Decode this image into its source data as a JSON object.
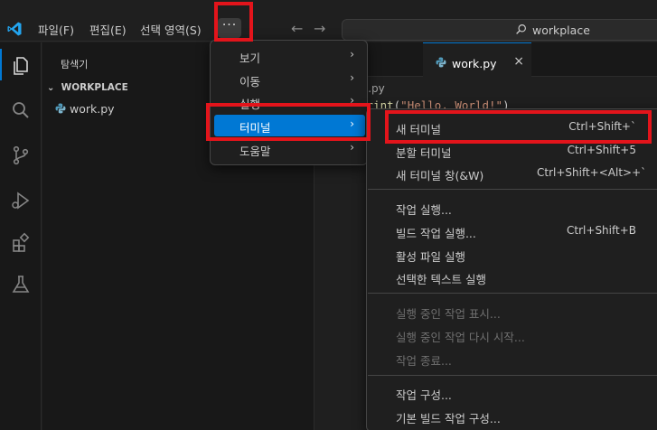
{
  "titlebar": {
    "menus": [
      "파일(F)",
      "편집(E)",
      "선택 영역(S)"
    ],
    "more_label": "···",
    "back_glyph": "←",
    "forward_glyph": "→",
    "search_text": "workplace"
  },
  "sidebar": {
    "title": "탐색기",
    "section": "WORKPLACE",
    "chevron": "⌄",
    "files": [
      "work.py"
    ]
  },
  "editor": {
    "tab_label": "work.py",
    "tab_close": "×",
    "breadcrumb": "ork.py",
    "code_fn": "print",
    "code_open": "(",
    "code_str": "\"Hello, World!\"",
    "code_close": ")"
  },
  "main_menu": {
    "items": [
      {
        "label": "보기",
        "arrow": "›"
      },
      {
        "label": "이동",
        "arrow": "›"
      },
      {
        "label": "실행",
        "arrow": "›"
      },
      {
        "label": "터미널",
        "arrow": "›"
      },
      {
        "label": "도움말",
        "arrow": "›"
      }
    ],
    "selected_index": 3
  },
  "terminal_menu": {
    "items": [
      {
        "label": "새 터미널",
        "shortcut": "Ctrl+Shift+`"
      },
      {
        "label": "분할 터미널",
        "shortcut": "Ctrl+Shift+5"
      },
      {
        "label": "새 터미널 창(&W)",
        "shortcut": "Ctrl+Shift+<Alt>+`"
      },
      {
        "label": "작업 실행...",
        "shortcut": ""
      },
      {
        "label": "빌드 작업 실행...",
        "shortcut": "Ctrl+Shift+B"
      },
      {
        "label": "활성 파일 실행",
        "shortcut": ""
      },
      {
        "label": "선택한 텍스트 실행",
        "shortcut": ""
      },
      {
        "label": "실행 중인 작업 표시...",
        "shortcut": ""
      },
      {
        "label": "실행 중인 작업 다시 시작...",
        "shortcut": ""
      },
      {
        "label": "작업 종료...",
        "shortcut": ""
      },
      {
        "label": "작업 구성...",
        "shortcut": ""
      },
      {
        "label": "기본 빌드 작업 구성...",
        "shortcut": ""
      }
    ]
  },
  "colors": {
    "accent": "#0078d4",
    "highlight": "#e3141b",
    "background": "#1f1f1f"
  }
}
